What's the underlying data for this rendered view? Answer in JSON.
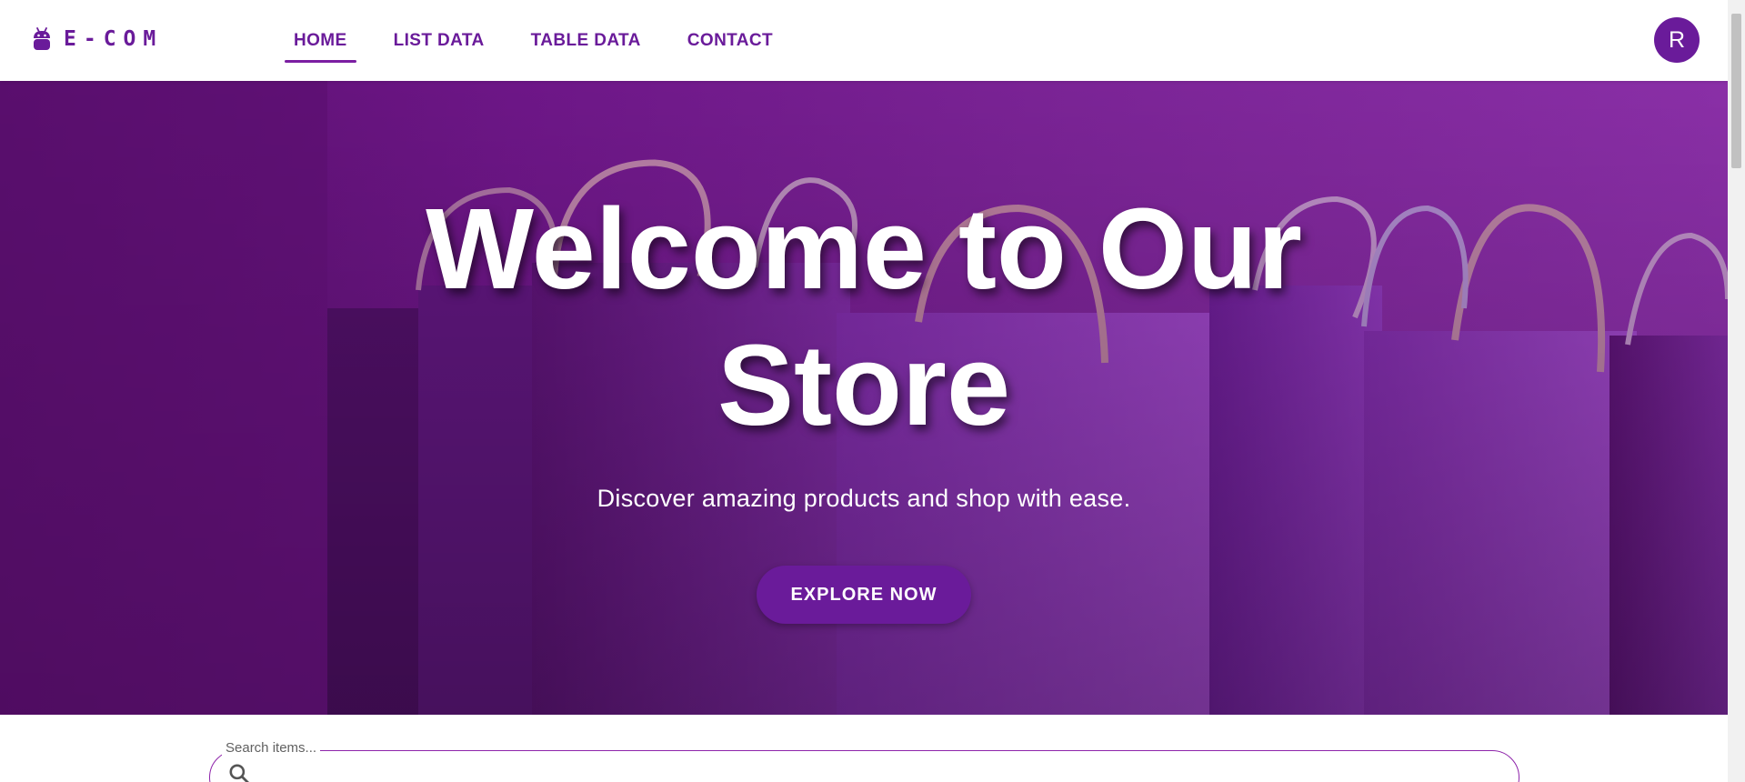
{
  "brand": {
    "name": "E-COM",
    "icon": "android-icon",
    "color": "#6a1b9a"
  },
  "nav": {
    "items": [
      {
        "label": "HOME",
        "active": true
      },
      {
        "label": "LIST DATA",
        "active": false
      },
      {
        "label": "TABLE DATA",
        "active": false
      },
      {
        "label": "CONTACT",
        "active": false
      }
    ]
  },
  "user": {
    "avatar_initial": "R"
  },
  "hero": {
    "title": "Welcome to Our Store",
    "subtitle": "Discover amazing products and shop with ease.",
    "button_label": "EXPLORE NOW"
  },
  "search": {
    "label": "Search items...",
    "value": "",
    "icon": "search-icon"
  },
  "colors": {
    "accent": "#6a1b9a",
    "hero_bg": "#7a2395"
  }
}
